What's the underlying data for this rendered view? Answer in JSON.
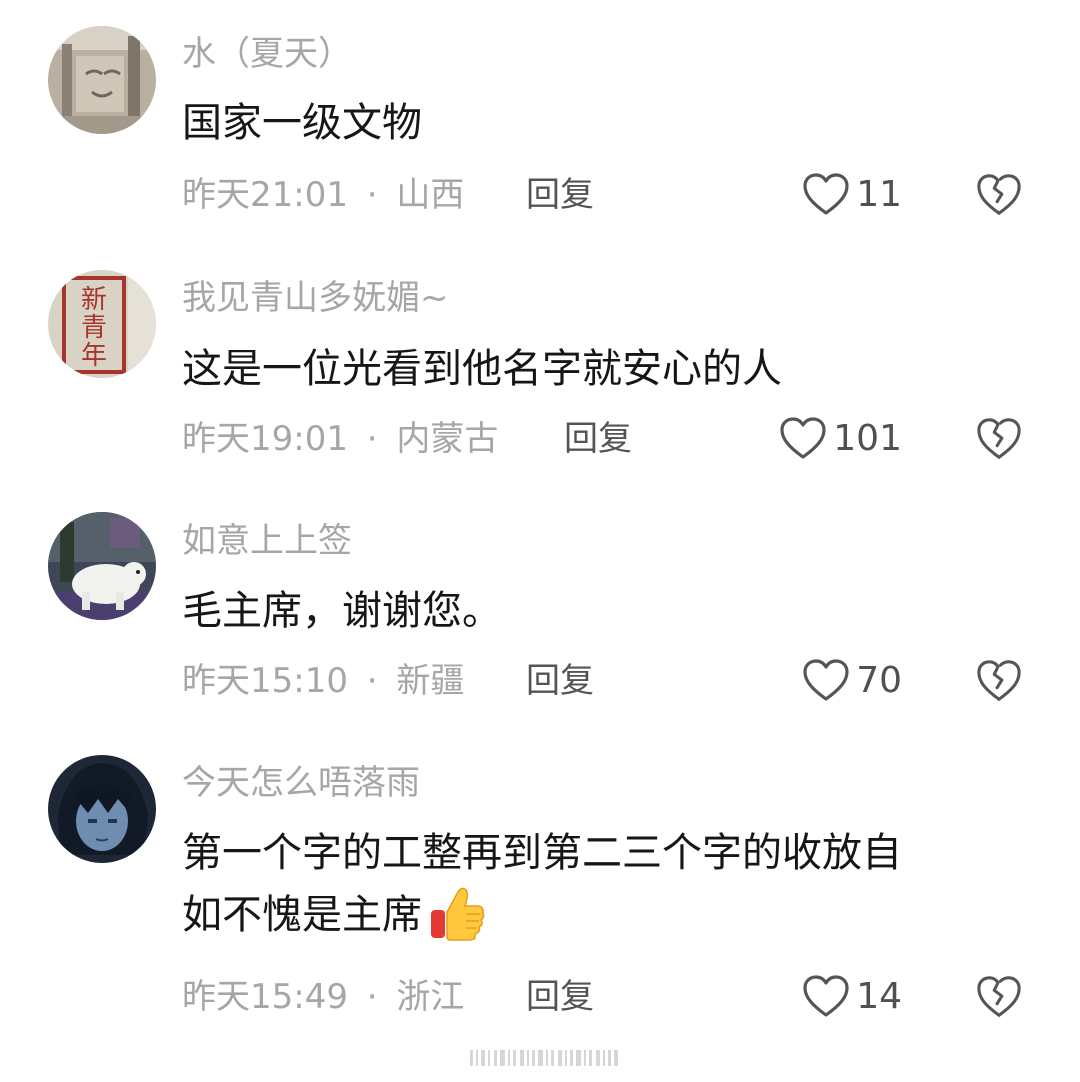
{
  "comments": [
    {
      "username": "水（夏天）",
      "text": [
        "国家一级文物"
      ],
      "time": "昨天21:01",
      "location": "山西",
      "reply_label": "回复",
      "likes": "11",
      "avatar": "wall-photo-avatar"
    },
    {
      "username": "我见青山多妩媚~",
      "text": [
        "这是一位光看到他名字就安心的人"
      ],
      "time": "昨天19:01",
      "location": "内蒙古",
      "reply_label": "回复",
      "likes": "101",
      "avatar": "xinqingnian-seal-avatar",
      "avatar_text": "新青年"
    },
    {
      "username": "如意上上签",
      "text": [
        "毛主席，谢谢您。"
      ],
      "time": "昨天15:10",
      "location": "新疆",
      "reply_label": "回复",
      "likes": "70",
      "avatar": "polar-bear-game-avatar"
    },
    {
      "username": "今天怎么唔落雨",
      "text": [
        "第一个字的工整再到第二三个字的收放自",
        "如不愧是主席"
      ],
      "time": "昨天15:49",
      "location": "浙江",
      "reply_label": "回复",
      "likes": "14",
      "avatar": "anime-character-avatar",
      "emoji": "thumbs-up-emoji"
    }
  ],
  "meta_separator": "·",
  "colors": {
    "username": "#a6a6a6",
    "text": "#161616",
    "meta": "#a6a6a6",
    "reply": "#545454",
    "icon": "#555555"
  }
}
